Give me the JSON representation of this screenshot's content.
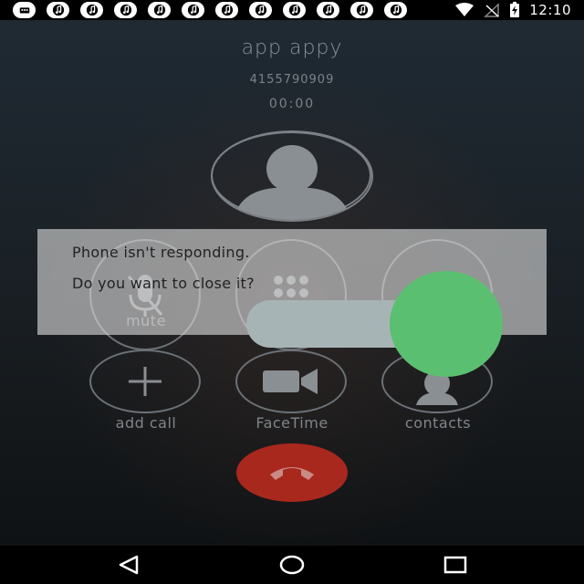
{
  "status_bar": {
    "time": "12:10",
    "notification_icons": [
      "messages-icon",
      "music-icon",
      "music-icon",
      "music-icon",
      "music-icon",
      "music-icon",
      "music-icon",
      "music-icon",
      "music-icon",
      "music-icon",
      "music-icon",
      "music-icon"
    ],
    "right_icons": [
      "wifi-icon",
      "no-signal-icon",
      "battery-charging-icon"
    ]
  },
  "call": {
    "caller_name": "app appy",
    "number": "4155790909",
    "timer": "00:00",
    "buttons": [
      {
        "label": "mute",
        "icon": "mic-off-icon"
      },
      {
        "label": "",
        "icon": "keypad-icon"
      },
      {
        "label": "",
        "icon": "speaker-icon"
      },
      {
        "label": "add call",
        "icon": "plus-icon"
      },
      {
        "label": "FaceTime",
        "icon": "video-camera-icon"
      },
      {
        "label": "contacts",
        "icon": "contacts-icon"
      }
    ],
    "end_call_color": "#a9281e"
  },
  "dialog": {
    "line1": "Phone isn't responding.",
    "line2": "Do you want to close it?",
    "toggle_color": "#5bbf72"
  },
  "nav": {
    "icons": [
      "back-icon",
      "home-icon",
      "recents-icon"
    ]
  }
}
